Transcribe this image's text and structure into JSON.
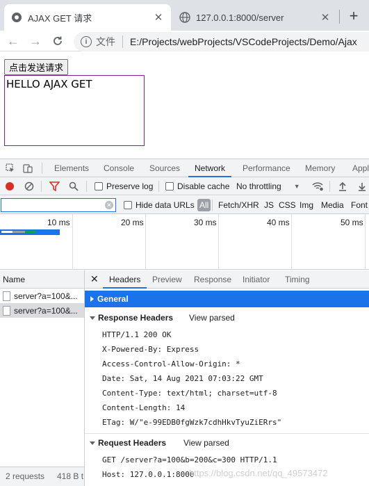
{
  "browser": {
    "tabs": [
      {
        "title": "AJAX GET 请求"
      },
      {
        "title": "127.0.0.1:8000/server"
      }
    ],
    "address": {
      "scheme_label": "文件",
      "url": "E:/Projects/webProjects/VSCodeProjects/Demo/Ajax"
    }
  },
  "page": {
    "button_label": "点击发送请求",
    "result_text": "HELLO AJAX GET",
    "result_border_color": "#8b1aa0"
  },
  "devtools": {
    "panel_tabs": [
      "Elements",
      "Console",
      "Sources",
      "Network",
      "Performance",
      "Memory",
      "Appl"
    ],
    "selected_panel": "Network",
    "toolbar": {
      "preserve_log": "Preserve log",
      "disable_cache": "Disable cache",
      "throttling": "No throttling"
    },
    "filter": {
      "value": "",
      "hide_data_urls": "Hide data URLs",
      "types": [
        "All",
        "Fetch/XHR",
        "JS",
        "CSS",
        "Img",
        "Media",
        "Font"
      ]
    },
    "timeline": {
      "ticks": [
        "10 ms",
        "20 ms",
        "30 ms",
        "40 ms",
        "50 ms"
      ]
    },
    "request_list": {
      "header": "Name",
      "rows": [
        "server?a=100&...",
        "server?a=100&..."
      ],
      "selected_index": 1
    },
    "status": {
      "requests": "2 requests",
      "transferred": "418 B t"
    },
    "detail": {
      "tabs": [
        "Headers",
        "Preview",
        "Response",
        "Initiator",
        "Timing"
      ],
      "selected_tab": "Headers",
      "general_label": "General",
      "response_headers": {
        "title": "Response Headers",
        "view_parsed": "View parsed",
        "lines": [
          "HTTP/1.1 200 OK",
          "X-Powered-By: Express",
          "Access-Control-Allow-Origin: *",
          "Date: Sat, 14 Aug 2021 07:03:22 GMT",
          "Content-Type: text/html; charset=utf-8",
          "Content-Length: 14",
          "ETag: W/\"e-99EDB0fgWzk7cdhHkvTyuZiERrs\""
        ]
      },
      "request_headers": {
        "title": "Request Headers",
        "view_parsed": "View parsed",
        "lines": [
          "GET /server?a=100&b=200&c=300 HTTP/1.1",
          "Host: 127.0.0.1:8000"
        ]
      }
    }
  },
  "watermark": "https://blog.csdn.net/qq_49573472",
  "colors": {
    "accent": "#1a73e8",
    "record": "#d93025",
    "filter_icon": "#d93025"
  }
}
